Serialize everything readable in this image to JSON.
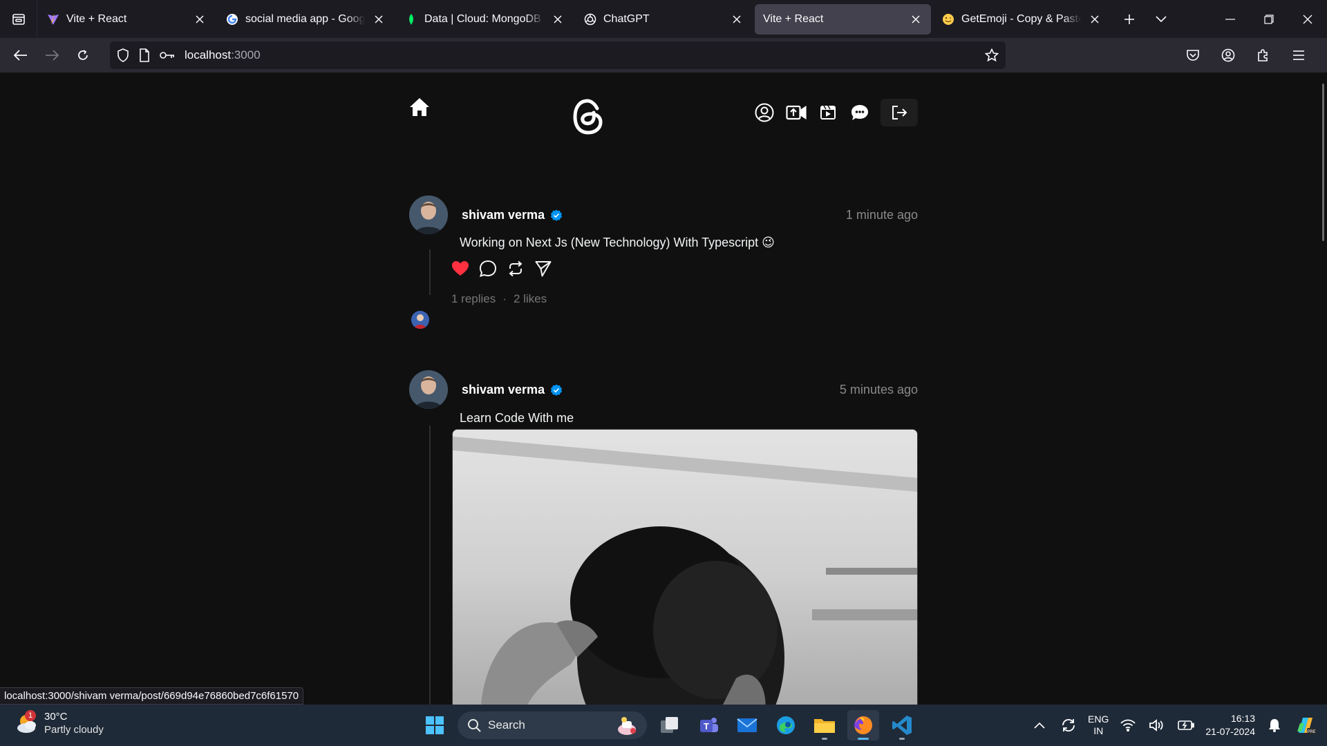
{
  "browser": {
    "tabs": [
      {
        "title": "Vite + React",
        "favicon": "vite-icon",
        "active": false
      },
      {
        "title": "social media app - Google Search",
        "favicon": "google-icon",
        "active": false
      },
      {
        "title": "Data | Cloud: MongoDB Cloud",
        "favicon": "mongodb-icon",
        "active": false
      },
      {
        "title": "ChatGPT",
        "favicon": "chatgpt-icon",
        "active": false
      },
      {
        "title": "Vite + React",
        "favicon": "none",
        "active": true
      },
      {
        "title": "GetEmoji - Copy & Paste All Emojis",
        "favicon": "emoji-icon",
        "active": false
      }
    ],
    "url_host": "localhost",
    "url_port": ":3000",
    "status_link": "localhost:3000/shivam verma/post/669d94e76860bed7c6f61570"
  },
  "posts": [
    {
      "username": "shivam verma",
      "verified": true,
      "time": "1 minute ago",
      "text": "Working on Next Js (New Technology) With Typescript 😉",
      "replies": "1 replies",
      "separator": "·",
      "likes": "2 likes",
      "liked": true
    },
    {
      "username": "shivam verma",
      "verified": true,
      "time": "5 minutes ago",
      "text": "Learn Code With me",
      "has_image": true
    }
  ],
  "taskbar": {
    "weather_temp": "30°C",
    "weather_desc": "Partly cloudy",
    "weather_badge": "1",
    "search_label": "Search",
    "lang_line1": "ENG",
    "lang_line2": "IN",
    "time": "16:13",
    "date": "21-07-2024"
  },
  "colors": {
    "accent_like": "#ff3040",
    "verified_blue": "#0095f6",
    "page_bg": "#101010"
  }
}
